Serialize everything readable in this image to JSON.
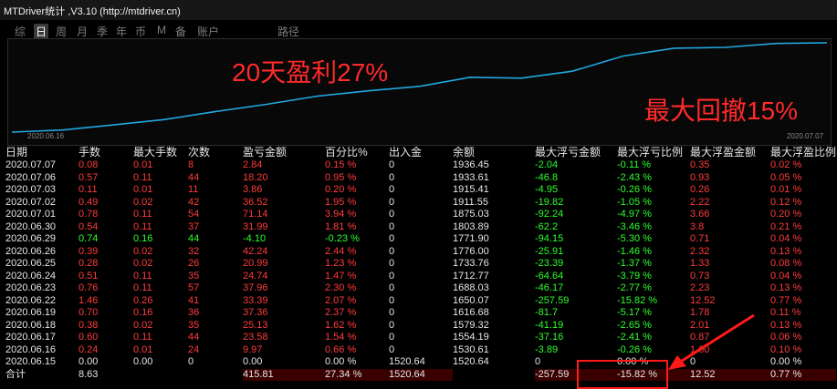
{
  "app": {
    "title": "MTDriver统计 ,V3.10 (http://mtdriver.cn)"
  },
  "toolbar": {
    "items": [
      "综",
      "日",
      "周",
      "月",
      "季",
      "年",
      "币",
      "M",
      "备",
      "账户",
      "路径"
    ],
    "active": "日"
  },
  "chart": {
    "start_date": "2020.06.16",
    "end_date": "2020.07.07",
    "line_color": "#22a7e0",
    "annotation_profit": "20天盈利27%",
    "annotation_drawdown": "最大回撤15%",
    "annotation_color": "#ff2a2a"
  },
  "table": {
    "headers": [
      "日期",
      "手数",
      "最大手数",
      "次数",
      "盈亏金额",
      "百分比%",
      "出入金",
      "余额",
      "最大浮亏金额",
      "最大浮亏比例",
      "最大浮盈金额",
      "最大浮盈比例"
    ],
    "rows": [
      [
        "2020.07.07",
        "0.08",
        "0.01",
        "8",
        "2.84",
        "0.15 %",
        "0",
        "1936.45",
        "-2.04",
        "-0.11 %",
        "0.35",
        "0.02 %"
      ],
      [
        "2020.07.06",
        "0.57",
        "0.11",
        "44",
        "18.20",
        "0.95 %",
        "0",
        "1933.61",
        "-46.8",
        "-2.43 %",
        "0.93",
        "0.05 %"
      ],
      [
        "2020.07.03",
        "0.11",
        "0.01",
        "11",
        "3.86",
        "0.20 %",
        "0",
        "1915.41",
        "-4.95",
        "-0.26 %",
        "0.26",
        "0.01 %"
      ],
      [
        "2020.07.02",
        "0.49",
        "0.02",
        "42",
        "36.52",
        "1.95 %",
        "0",
        "1911.55",
        "-19.82",
        "-1.05 %",
        "2.22",
        "0.12 %"
      ],
      [
        "2020.07.01",
        "0.78",
        "0.11",
        "54",
        "71.14",
        "3.94 %",
        "0",
        "1875.03",
        "-92.24",
        "-4.97 %",
        "3.66",
        "0.20 %"
      ],
      [
        "2020.06.30",
        "0.54",
        "0.11",
        "37",
        "31.99",
        "1.81 %",
        "0",
        "1803.89",
        "-62.2",
        "-3.46 %",
        "3.8",
        "0.21 %"
      ],
      [
        "2020.06.29",
        "0.74",
        "0.16",
        "44",
        "-4.10",
        "-0.23 %",
        "0",
        "1771.90",
        "-94.15",
        "-5.30 %",
        "0.71",
        "0.04 %"
      ],
      [
        "2020.06.26",
        "0.39",
        "0.02",
        "32",
        "42.24",
        "2.44 %",
        "0",
        "1776.00",
        "-25.91",
        "-1.46 %",
        "2.32",
        "0.13 %"
      ],
      [
        "2020.06.25",
        "0.28",
        "0.02",
        "26",
        "20.99",
        "1.23 %",
        "0",
        "1733.76",
        "-23.39",
        "-1.37 %",
        "1.33",
        "0.08 %"
      ],
      [
        "2020.06.24",
        "0.51",
        "0.11",
        "35",
        "24.74",
        "1.47 %",
        "0",
        "1712.77",
        "-64.64",
        "-3.79 %",
        "0.73",
        "0.04 %"
      ],
      [
        "2020.06.23",
        "0.76",
        "0.11",
        "57",
        "37.96",
        "2.30 %",
        "0",
        "1688.03",
        "-46.17",
        "-2.77 %",
        "2.23",
        "0.13 %"
      ],
      [
        "2020.06.22",
        "1.46",
        "0.26",
        "41",
        "33.39",
        "2.07 %",
        "0",
        "1650.07",
        "-257.59",
        "-15.82 %",
        "12.52",
        "0.77 %"
      ],
      [
        "2020.06.19",
        "0.70",
        "0.16",
        "36",
        "37.36",
        "2.37 %",
        "0",
        "1616.68",
        "-81.7",
        "-5.17 %",
        "1.78",
        "0.11 %"
      ],
      [
        "2020.06.18",
        "0.38",
        "0.02",
        "35",
        "25.13",
        "1.62 %",
        "0",
        "1579.32",
        "-41.19",
        "-2.65 %",
        "2.01",
        "0.13 %"
      ],
      [
        "2020.06.17",
        "0.60",
        "0.11",
        "44",
        "23.58",
        "1.54 %",
        "0",
        "1554.19",
        "-37.16",
        "-2.41 %",
        "0.87",
        "0.06 %"
      ],
      [
        "2020.06.16",
        "0.24",
        "0.01",
        "24",
        "9.97",
        "0.66 %",
        "0",
        "1530.61",
        "-3.89",
        "-0.26 %",
        "1.60",
        "0.10 %"
      ],
      [
        "2020.06.15",
        "0.00",
        "0.00",
        "0",
        "0.00",
        "0.00 %",
        "1520.64",
        "1520.64",
        "0",
        "0.00 %",
        "0",
        "0.00 %"
      ]
    ],
    "total": [
      "合计",
      "8.63",
      "",
      "",
      "415.81",
      "27.34 %",
      "1520.64",
      "",
      "-257.59",
      "-15.82 %",
      "12.52",
      "0.77 %"
    ]
  }
}
